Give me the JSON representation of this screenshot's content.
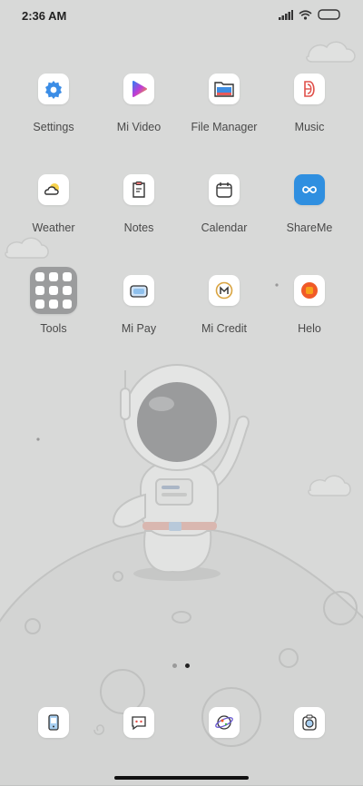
{
  "status_bar": {
    "time": "2:36 AM"
  },
  "apps": [
    {
      "label": "Settings"
    },
    {
      "label": "Mi Video"
    },
    {
      "label": "File Manager"
    },
    {
      "label": "Music"
    },
    {
      "label": "Weather"
    },
    {
      "label": "Notes"
    },
    {
      "label": "Calendar"
    },
    {
      "label": "ShareMe"
    },
    {
      "label": "Tools"
    },
    {
      "label": "Mi Pay"
    },
    {
      "label": "Mi Credit"
    },
    {
      "label": "Helo"
    }
  ],
  "page_indicator": {
    "pages": 2,
    "current": 2
  },
  "dock": [
    {
      "icon": "phone-icon"
    },
    {
      "icon": "messages-icon"
    },
    {
      "icon": "browser-icon"
    },
    {
      "icon": "camera-icon"
    }
  ],
  "colors": {
    "wallpaper": "#d8d9d8",
    "accent_blue": "#2f8fe0",
    "helo_orange": "#f05a28"
  }
}
